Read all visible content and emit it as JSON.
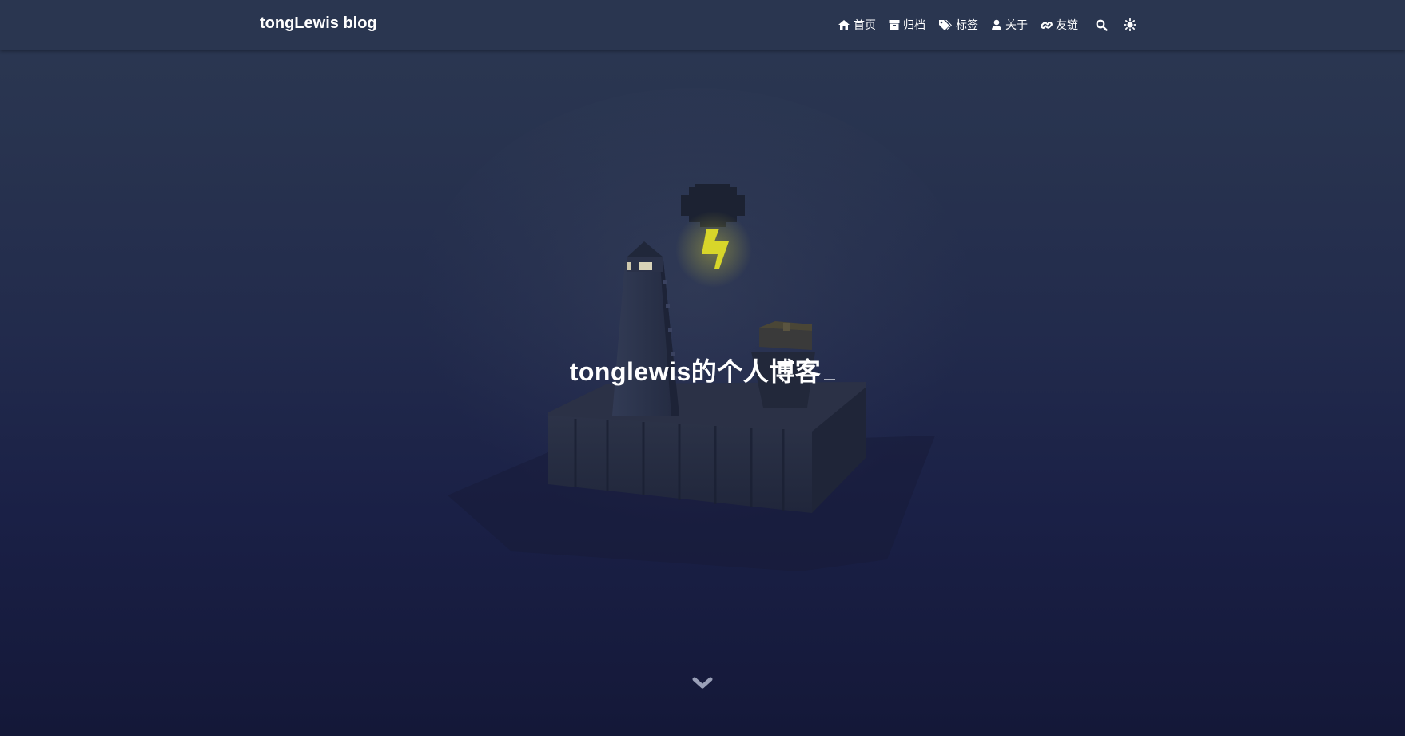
{
  "header": {
    "brand": "tongLewis blog",
    "nav": [
      {
        "label": "首页",
        "icon": "home-icon"
      },
      {
        "label": "归档",
        "icon": "archive-icon"
      },
      {
        "label": "标签",
        "icon": "tags-icon"
      },
      {
        "label": "关于",
        "icon": "user-icon"
      },
      {
        "label": "友链",
        "icon": "link-icon"
      }
    ],
    "search_icon": "search-icon",
    "theme_icon": "sun-icon"
  },
  "hero": {
    "title": "tonglewis的个人博客",
    "scroll_icon": "chevron-down-icon"
  },
  "colors": {
    "navbar_bg": "#2a3650",
    "page_bg_top": "#2b3852",
    "page_bg_bottom": "#141838",
    "lightning": "#d8d62a",
    "text": "#ffffff"
  }
}
